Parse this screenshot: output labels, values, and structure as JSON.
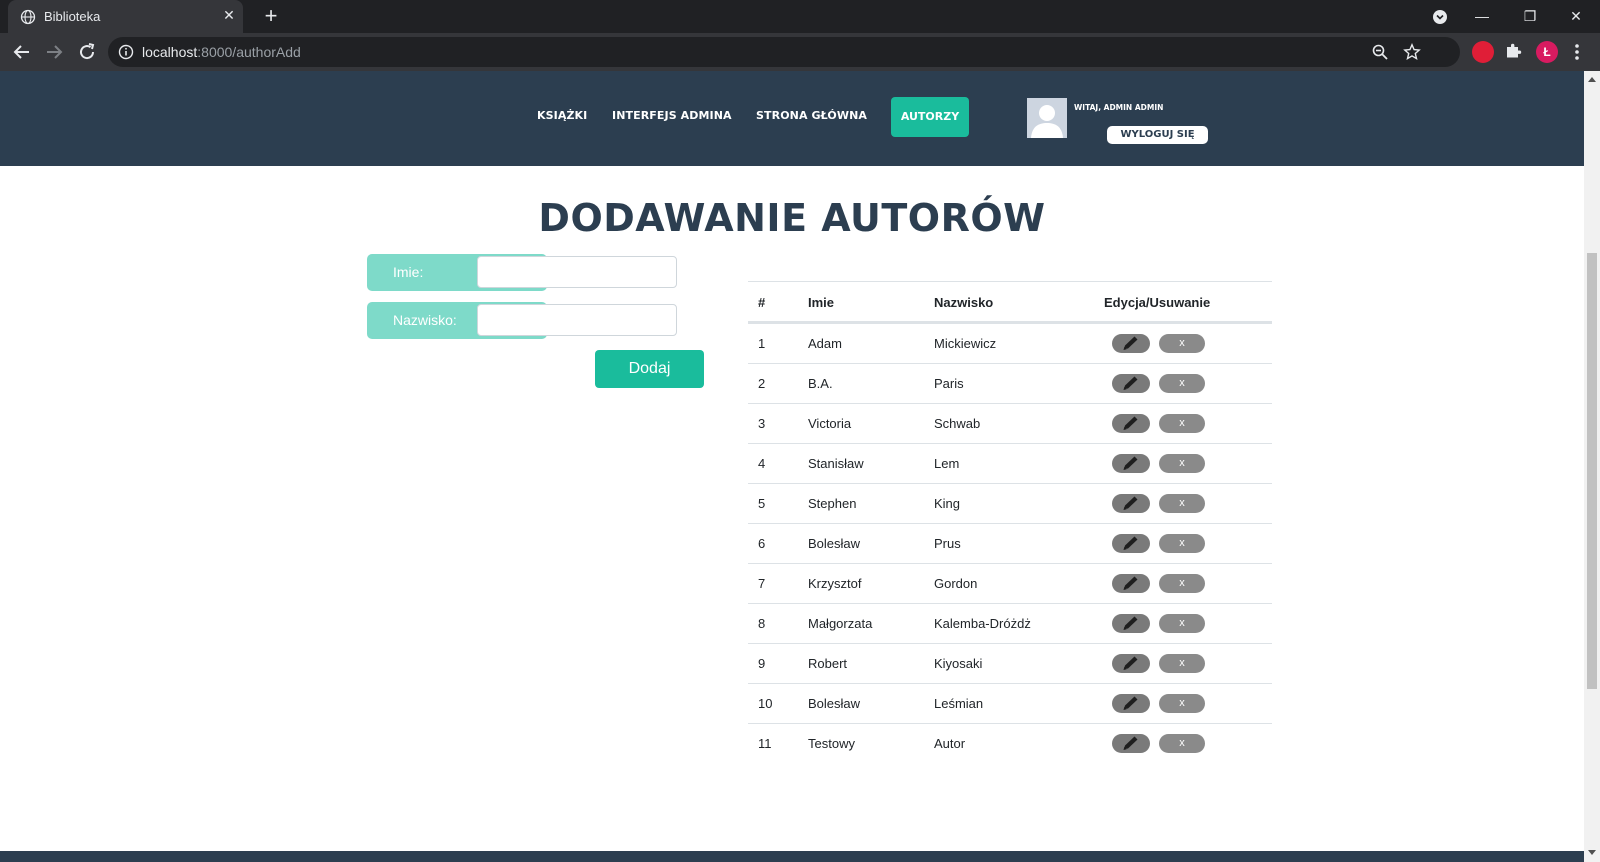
{
  "browser": {
    "tab_title": "Biblioteka",
    "tab_close": "✕",
    "new_tab": "+",
    "url_host": "localhost",
    "url_rest": ":8000/authorAdd",
    "window_controls": {
      "minimize": "—",
      "restore": "❐",
      "close": "✕"
    },
    "profile_initial": "Ł"
  },
  "header": {
    "nav": [
      "KSIĄŻKI",
      "INTERFEJS ADMINA",
      "STRONA GŁÓWNA"
    ],
    "active_nav": "AUTORZY",
    "welcome": "WITAJ, ADMIN ADMIN",
    "logout": "WYLOGUJ SIĘ"
  },
  "page_title": "DODAWANIE AUTORÓW",
  "form": {
    "first_name_label": "Imie:",
    "first_name_value": "",
    "last_name_label": "Nazwisko:",
    "last_name_value": "",
    "submit": "Dodaj"
  },
  "table": {
    "headers": [
      "#",
      "Imie",
      "Nazwisko",
      "Edycja/Usuwanie"
    ],
    "delete_label": "x",
    "rows": [
      [
        "1",
        "Adam",
        "Mickiewicz"
      ],
      [
        "2",
        "B.A.",
        "Paris"
      ],
      [
        "3",
        "Victoria",
        "Schwab"
      ],
      [
        "4",
        "Stanisław",
        "Lem"
      ],
      [
        "5",
        "Stephen",
        "King"
      ],
      [
        "6",
        "Bolesław",
        "Prus"
      ],
      [
        "7",
        "Krzysztof",
        "Gordon"
      ],
      [
        "8",
        "Małgorzata",
        "Kalemba-Dróżdż"
      ],
      [
        "9",
        "Robert",
        "Kiyosaki"
      ],
      [
        "10",
        "Bolesław",
        "Leśmian"
      ],
      [
        "11",
        "Testowy",
        "Autor"
      ]
    ]
  },
  "colors": {
    "header_bg": "#2c3e50",
    "accent": "#1abc9c",
    "label_bg": "#7edac9"
  }
}
